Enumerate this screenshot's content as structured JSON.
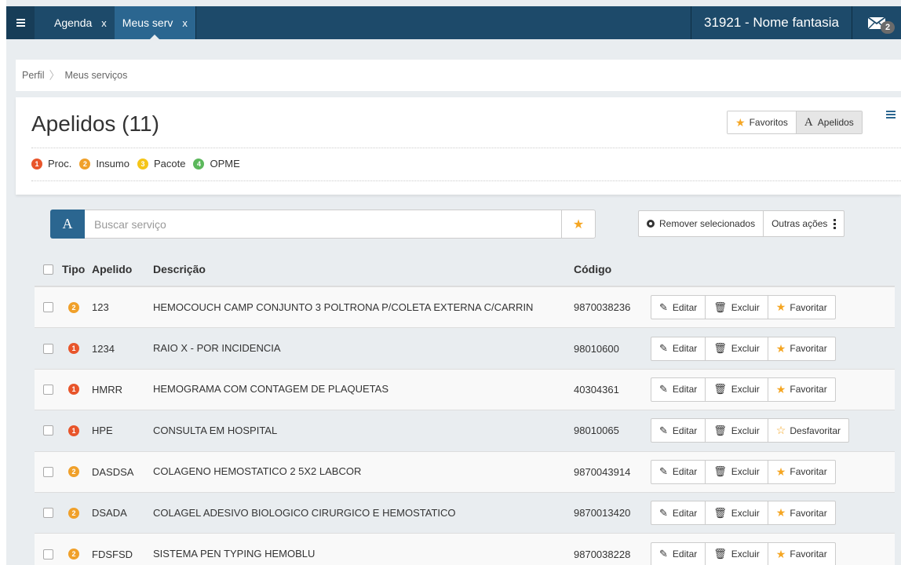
{
  "topbar": {
    "tabs": [
      {
        "label": "Agenda",
        "close": "x",
        "active": false
      },
      {
        "label": "Meus serv",
        "close": "x",
        "active": true
      }
    ],
    "org_name": "31921 - Nome fantasia",
    "mail_count": "2"
  },
  "breadcrumb": {
    "items": [
      "Perfil",
      "Meus serviços"
    ]
  },
  "page": {
    "title": "Apelidos (11)",
    "view_toggle": {
      "favoritos": "Favoritos",
      "apelidos": "Apelidos",
      "apelidos_glyph": "A"
    }
  },
  "legend": [
    {
      "num": "1",
      "label": "Proc.",
      "color": "#e8552b"
    },
    {
      "num": "2",
      "label": "Insumo",
      "color": "#f0a02a"
    },
    {
      "num": "3",
      "label": "Pacote",
      "color": "#f5c518"
    },
    {
      "num": "4",
      "label": "OPME",
      "color": "#5cb85c"
    }
  ],
  "search": {
    "placeholder": "Buscar serviço",
    "mode_glyph": "A"
  },
  "actions": {
    "remove": "Remover selecionados",
    "more": "Outras ações"
  },
  "table": {
    "headers": {
      "tipo": "Tipo",
      "apelido": "Apelido",
      "descricao": "Descrição",
      "codigo": "Código"
    },
    "buttons": {
      "edit": "Editar",
      "delete": "Excluir"
    },
    "rows": [
      {
        "tipo": "2",
        "apelido": "123",
        "descricao": "HEMOCOUCH CAMP CONJUNTO 3 POLTRONA P/COLETA EXTERNA C/CARRIN",
        "codigo": "9870038236",
        "fav": "Favoritar"
      },
      {
        "tipo": "1",
        "apelido": "1234",
        "descricao": "RAIO X - POR INCIDENCIA",
        "codigo": "98010600",
        "fav": "Favoritar"
      },
      {
        "tipo": "1",
        "apelido": "HMRR",
        "descricao": "HEMOGRAMA COM CONTAGEM DE PLAQUETAS",
        "codigo": "40304361",
        "fav": "Favoritar"
      },
      {
        "tipo": "1",
        "apelido": "HPE",
        "descricao": "CONSULTA EM HOSPITAL",
        "codigo": "98010065",
        "fav": "Desfavoritar"
      },
      {
        "tipo": "2",
        "apelido": "DASDSA",
        "descricao": "COLAGENO HEMOSTATICO 2 5X2 LABCOR",
        "codigo": "9870043914",
        "fav": "Favoritar"
      },
      {
        "tipo": "2",
        "apelido": "DSADA",
        "descricao": "COLAGEL ADESIVO BIOLOGICO CIRURGICO E HEMOSTATICO",
        "codigo": "9870013420",
        "fav": "Favoritar"
      },
      {
        "tipo": "2",
        "apelido": "FDSFSD",
        "descricao": "SISTEMA PEN TYPING HEMOBLU",
        "codigo": "9870038228",
        "fav": "Favoritar"
      }
    ]
  }
}
